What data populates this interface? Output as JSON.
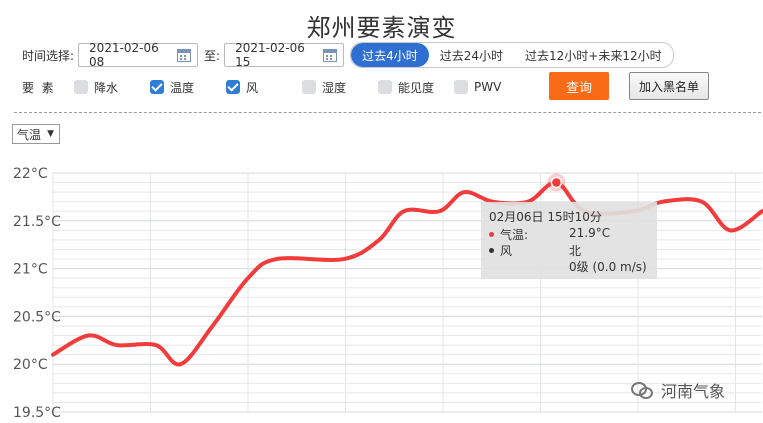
{
  "page_title": "郑州要素演变",
  "time_select": {
    "label": "时间选择:",
    "start": "2021-02-06 08",
    "to_label": "至:",
    "end": "2021-02-06 15",
    "presets": [
      {
        "label": "过去4小时",
        "active": true
      },
      {
        "label": "过去24小时",
        "active": false
      },
      {
        "label": "过去12小时+未来12小时",
        "active": false
      }
    ]
  },
  "elements": {
    "label": "要  素",
    "options": [
      {
        "label": "降水",
        "checked": false
      },
      {
        "label": "温度",
        "checked": true
      },
      {
        "label": "风",
        "checked": true
      },
      {
        "label": "湿度",
        "checked": false
      },
      {
        "label": "能见度",
        "checked": false
      },
      {
        "label": "PWV",
        "checked": false
      }
    ]
  },
  "buttons": {
    "query": "查询",
    "blacklist": "加入黑名单"
  },
  "variable_select": {
    "value": "气温"
  },
  "chart_data": {
    "type": "line",
    "series": [
      {
        "color": "#f23b3b",
        "points": [
          [
            0,
            20.1
          ],
          [
            0.05,
            20.3
          ],
          [
            0.09,
            20.2
          ],
          [
            0.145,
            20.2
          ],
          [
            0.18,
            20.0
          ],
          [
            0.225,
            20.4
          ],
          [
            0.275,
            20.9
          ],
          [
            0.315,
            21.1
          ],
          [
            0.41,
            21.1
          ],
          [
            0.46,
            21.3
          ],
          [
            0.495,
            21.6
          ],
          [
            0.545,
            21.6
          ],
          [
            0.58,
            21.8
          ],
          [
            0.62,
            21.7
          ],
          [
            0.67,
            21.7
          ],
          [
            0.71,
            21.9
          ],
          [
            0.75,
            21.6
          ],
          [
            0.82,
            21.6
          ],
          [
            0.86,
            21.7
          ],
          [
            0.915,
            21.7
          ],
          [
            0.955,
            21.4
          ],
          [
            1.0,
            21.6
          ]
        ]
      }
    ],
    "yticks": [
      "22°C",
      "21.5°C",
      "21°C",
      "20.5°C",
      "20°C",
      "19.5°C"
    ],
    "ylim": [
      19.5,
      22.0
    ],
    "grid": true,
    "highlight": {
      "x": 0.71,
      "y": 21.9
    }
  },
  "tooltip": {
    "time": "02月06日 15时10分",
    "rows": [
      {
        "name": "气温:",
        "value": "21.9°C",
        "color": "#f23b3b"
      },
      {
        "name": "风",
        "value": "北",
        "color": "#333333"
      },
      {
        "name": "",
        "value": "0级 (0.0 m/s)",
        "color": ""
      }
    ]
  },
  "watermark": "河南气象"
}
